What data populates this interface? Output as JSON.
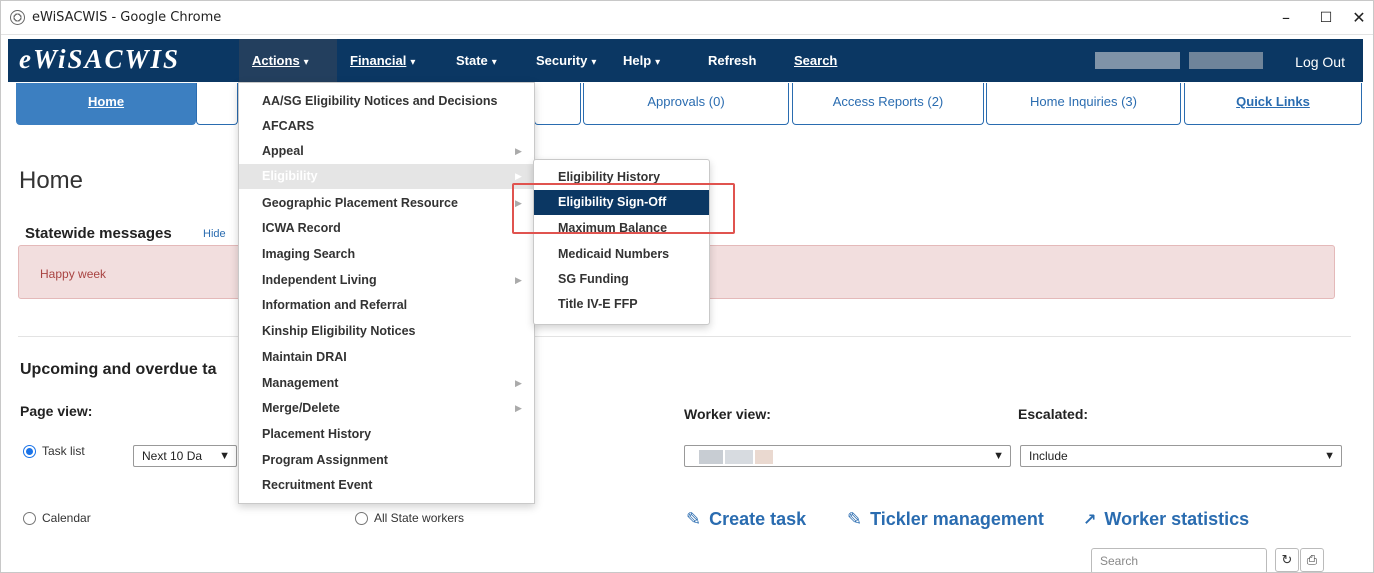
{
  "window": {
    "title": "eWiSACWIS - Google Chrome",
    "controls": [
      "–",
      "☐",
      "✕"
    ]
  },
  "nav": {
    "brand": "eWiSACWIS",
    "items": [
      {
        "label": "Actions",
        "caret": "▾"
      },
      {
        "label": "Financial",
        "caret": "▾"
      },
      {
        "label": "State",
        "caret": "▾"
      },
      {
        "label": "Security",
        "caret": "▾"
      },
      {
        "label": "Help",
        "caret": "▾"
      },
      {
        "label": "Refresh"
      },
      {
        "label": "Search"
      }
    ],
    "logout": "Log Out"
  },
  "tabs": {
    "home": "Home",
    "approvals": "Approvals (0)",
    "access_reports": "Access Reports (2)",
    "home_inquiries": "Home Inquiries (3)",
    "quick_links": "Quick Links"
  },
  "actions_menu": [
    {
      "label": "AA/SG Eligibility Notices and Decisions"
    },
    {
      "label": "AFCARS"
    },
    {
      "label": "Appeal",
      "submenu": true
    },
    {
      "label": "Eligibility",
      "submenu": true,
      "highlighted": true
    },
    {
      "label": "Geographic Placement Resource",
      "submenu": true
    },
    {
      "label": "ICWA Record"
    },
    {
      "label": "Imaging Search"
    },
    {
      "label": "Independent Living",
      "submenu": true
    },
    {
      "label": "Information and Referral"
    },
    {
      "label": "Kinship Eligibility Notices"
    },
    {
      "label": "Maintain DRAI"
    },
    {
      "label": "Management",
      "submenu": true
    },
    {
      "label": "Merge/Delete",
      "submenu": true
    },
    {
      "label": "Placement History"
    },
    {
      "label": "Program Assignment"
    },
    {
      "label": "Recruitment Event"
    }
  ],
  "eligibility_submenu": [
    {
      "label": "Eligibility History"
    },
    {
      "label": "Eligibility Sign-Off",
      "selected": true
    },
    {
      "label": "Maximum Balance"
    },
    {
      "label": "Medicaid Numbers"
    },
    {
      "label": "SG Funding"
    },
    {
      "label": "Title IV-E FFP"
    }
  ],
  "page": {
    "title": "Home",
    "statewide_title": "Statewide messages",
    "hide": "Hide",
    "message": "Happy week",
    "upcoming_title": "Upcoming and overdue ta",
    "page_view_label": "Page view:",
    "worker_view_label": "Worker view:",
    "escalated_label": "Escalated:",
    "radio_task_list": "Task list",
    "radio_calendar": "Calendar",
    "radio_all_state": "All State workers",
    "period_select": "Next 10 Da",
    "escalated_select": "Include",
    "create_task": "Create task",
    "tickler_management": "Tickler management",
    "worker_statistics": "Worker statistics",
    "search_placeholder": "Search"
  },
  "icons": {
    "edit": "✎",
    "chart": "📈",
    "refresh": "↻",
    "print": "⎙"
  },
  "colors": {
    "nav_bg": "#0b3763",
    "accent": "#2a6cb0",
    "selected_bg": "#0b3763",
    "highlight_box": "#e0534f",
    "alert_bg": "#f2dede",
    "alert_text": "#a94442"
  }
}
